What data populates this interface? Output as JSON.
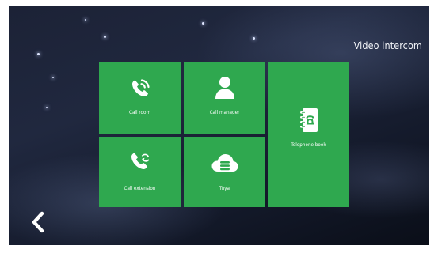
{
  "header": {
    "title": "Video intercom"
  },
  "tiles": [
    {
      "label": "Call room",
      "icon": "phone-call-icon"
    },
    {
      "label": "Call manager",
      "icon": "person-icon"
    },
    {
      "label": "Telephone book",
      "icon": "address-book-icon"
    },
    {
      "label": "Call extension",
      "icon": "phone-transfer-icon"
    },
    {
      "label": "Tuya",
      "icon": "cloud-icon"
    }
  ],
  "navigation": {
    "back_icon": "chevron-left-icon"
  },
  "colors": {
    "tile_green": "#2fa84f",
    "background": "#1c2236",
    "text": "#ffffff"
  }
}
